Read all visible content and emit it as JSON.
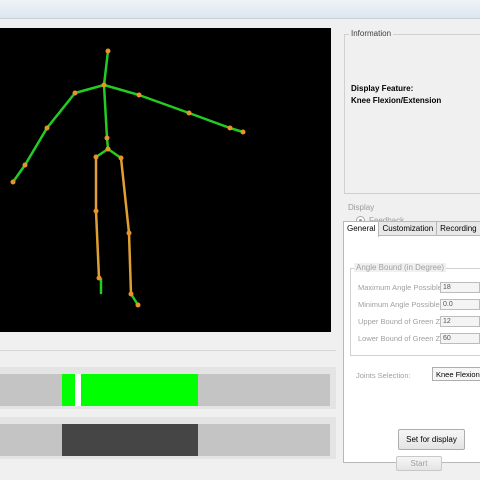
{
  "information": {
    "group_title": "Information",
    "feature_heading": "Display Feature:",
    "feature_value": "Knee Flexion/Extension"
  },
  "display": {
    "title": "Display",
    "feedback_label": "Feedback",
    "feedback_selected": true
  },
  "tabs": [
    {
      "label": "General",
      "active": true
    },
    {
      "label": "Customization",
      "active": false
    },
    {
      "label": "Recording",
      "active": false
    }
  ],
  "angle_bound": {
    "title": "Angle Bound (in Degree)",
    "fields": [
      {
        "label": "Maximum Angle Possible :",
        "value": "18"
      },
      {
        "label": "Minimum Angle Possible :",
        "value": "0.0"
      },
      {
        "label": "Upper Bound of Green Zone :",
        "value": "12"
      },
      {
        "label": "Lower Bound of Green Zone :",
        "value": "60"
      }
    ]
  },
  "joints": {
    "label": "Joints Selection:",
    "selected": "Knee Flexion"
  },
  "buttons": {
    "set_for_display": "Set for display",
    "start": "Start"
  },
  "colors": {
    "viewport_bg": "#000000",
    "bone_upper": "#22cc22",
    "bone_lower": "#e0a030",
    "joint": "#e8922a",
    "zone_green": "#00ff00",
    "marker": "#ffffff",
    "track": "#c4c4c4",
    "zone_dark": "#454545"
  },
  "icons": {
    "skeleton": "stick-figure-skeleton"
  }
}
